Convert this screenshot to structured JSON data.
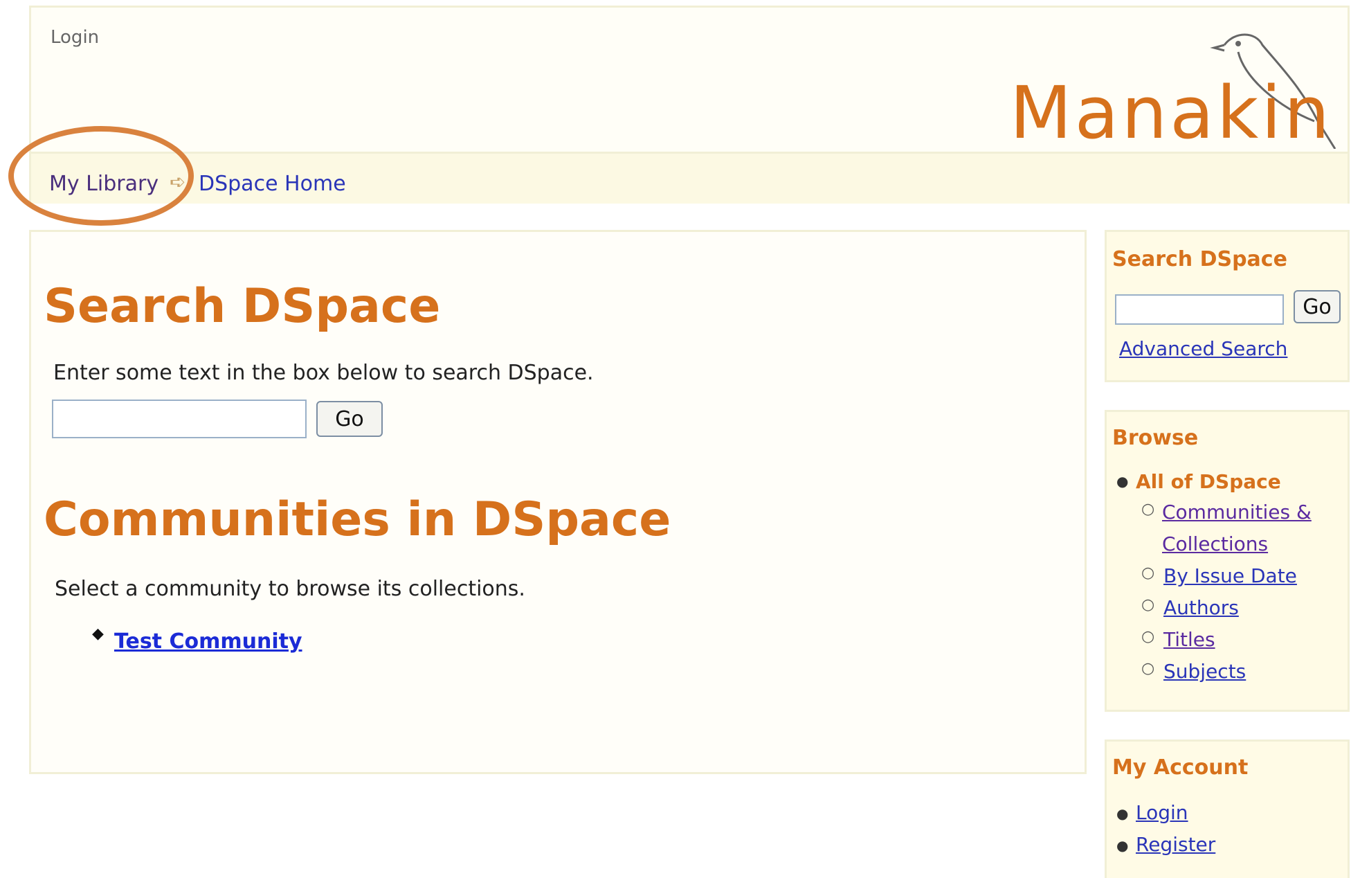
{
  "header": {
    "login_label": "Login",
    "logo_text": "Manakin"
  },
  "breadcrumb": {
    "my_library": "My Library",
    "dspace_home": "DSpace Home"
  },
  "main": {
    "search_heading": "Search DSpace",
    "search_instructions": "Enter some text in the box below to search DSpace.",
    "search_input_value": "",
    "go_label": "Go",
    "communities_heading": "Communities in DSpace",
    "communities_instructions": "Select a community to browse its collections.",
    "communities": [
      "Test Community"
    ]
  },
  "sidebar": {
    "search": {
      "heading": "Search DSpace",
      "input_value": "",
      "go_label": "Go",
      "advanced_search_label": "Advanced Search"
    },
    "browse": {
      "heading": "Browse",
      "scope_label": "All of DSpace",
      "items": [
        "Communities &",
        "Collections",
        "By Issue Date",
        "Authors",
        "Titles",
        "Subjects"
      ]
    },
    "account": {
      "heading": "My Account",
      "items": [
        "Login",
        "Register"
      ]
    }
  },
  "colors": {
    "accent_orange": "#d6711c",
    "link_blue": "#2a35b8",
    "highlight_circle": "#d9823e"
  }
}
